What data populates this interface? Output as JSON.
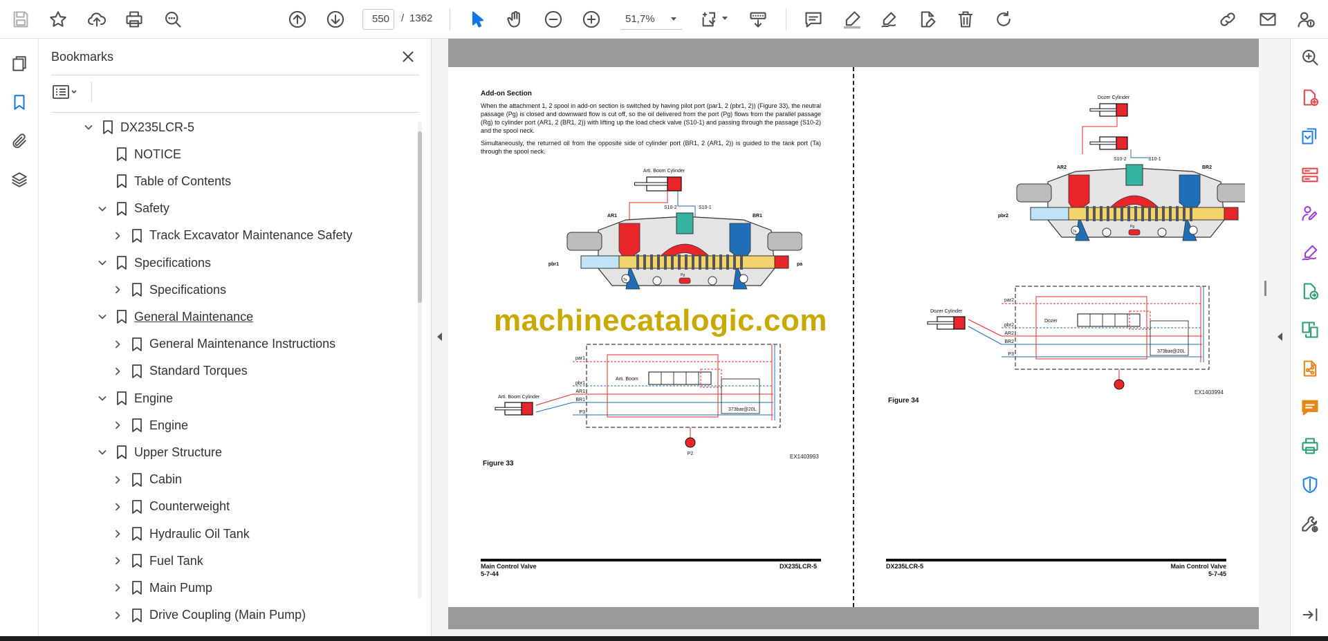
{
  "toolbar": {
    "page_current": "550",
    "page_separator": "/",
    "page_total": "1362",
    "zoom": "51,7%"
  },
  "bookmarks": {
    "title": "Bookmarks",
    "items": [
      {
        "label": "DX235LCR-5",
        "expanded": true
      },
      {
        "label": "NOTICE"
      },
      {
        "label": "Table of Contents"
      },
      {
        "label": "Safety",
        "expanded": true
      },
      {
        "label": "Track Excavator Maintenance Safety",
        "expanded": false
      },
      {
        "label": "Specifications",
        "expanded": true
      },
      {
        "label": "Specifications",
        "expanded": false
      },
      {
        "label": "General Maintenance",
        "expanded": true,
        "underlined": true
      },
      {
        "label": "General Maintenance Instructions",
        "expanded": false
      },
      {
        "label": "Standard Torques",
        "expanded": false
      },
      {
        "label": "Engine",
        "expanded": true
      },
      {
        "label": "Engine",
        "expanded": false
      },
      {
        "label": "Upper Structure",
        "expanded": true
      },
      {
        "label": "Cabin",
        "expanded": false
      },
      {
        "label": "Counterweight",
        "expanded": false
      },
      {
        "label": "Hydraulic Oil Tank",
        "expanded": false
      },
      {
        "label": "Fuel Tank",
        "expanded": false
      },
      {
        "label": "Main Pump",
        "expanded": false
      },
      {
        "label": "Drive Coupling (Main Pump)",
        "expanded": false
      }
    ]
  },
  "left_page": {
    "heading": "Add-on Section",
    "para1": "When the attachment 1, 2 spool in add-on section is switched by having pilot port (par1, 2 (pbr1, 2)) (Figure 33), the neutral passage (Pg) is closed and downward flow is cut off, so the oil delivered from the port (Pg) flows from the parallel passage (Rg) to cylinder port (AR1, 2 (BR1, 2)) with lifting up the load check valve (S10-1) and passing through the passage (S10-2) and the spool neck.",
    "para2": "Simultaneously, the returned oil from the opposite side of cylinder port (BR1, 2 (AR1, 2)) is guided to the tank port (Ta) through the spool neck.",
    "fig_labels": {
      "cyl": "Arti. Boom Cylinder",
      "s102": "S10-2",
      "s101": "S10-1",
      "ar": "AR1",
      "br": "BR1",
      "pbr": "pbr1",
      "par": "par1",
      "ta": "Ta",
      "pg": "Pg",
      "sch_par": "par1",
      "sch_pbr": "pbr1",
      "sch_ar": "AR1",
      "sch_br": "BR1",
      "sch_p3": "P3",
      "sch_valve": "Arti. Boom",
      "sch_cyl": "Arti. Boom Cylinder",
      "sch_rating": "373bar@20L",
      "pump": "P2"
    },
    "figure": "Figure 33",
    "code": "EX1403993",
    "footer_left_1": "Main Control Valve",
    "footer_left_2": "5-7-44",
    "footer_right": "DX235LCR-5"
  },
  "right_page": {
    "fig_labels": {
      "cyl": "Dozer Cylinder",
      "s102": "S10-2",
      "s101": "S10-1",
      "ar": "AR2",
      "br": "BR2",
      "pbr": "pbr2",
      "par": "par2",
      "ta": "Ta",
      "pg": "Pg",
      "sch_par": "par2",
      "sch_pbr": "pbr2",
      "sch_ar": "AR2",
      "sch_br": "BR2",
      "sch_p3": "P3",
      "sch_valve": "Dozer",
      "sch_cyl": "Dozer Cylinder",
      "sch_rating": "373bar@20L",
      "pump": "P2"
    },
    "figure": "Figure 34",
    "code": "EX1403994",
    "footer_left": "DX235LCR-5",
    "footer_right_1": "Main Control Valve",
    "footer_right_2": "5-7-45"
  },
  "watermark": "machinecatalogic.com",
  "colors": {
    "accent_blue": "#1473e6",
    "right_rail_red": "#e34850",
    "right_rail_blue": "#2680eb",
    "right_rail_purple": "#9c3fd6",
    "right_rail_green": "#2d9d78",
    "right_rail_orange": "#e68619",
    "hydraulic_red": "#e8262a",
    "hydraulic_blue": "#1f6fb8",
    "hydraulic_yellow": "#f3d36b",
    "watermark": "#c9a800"
  }
}
